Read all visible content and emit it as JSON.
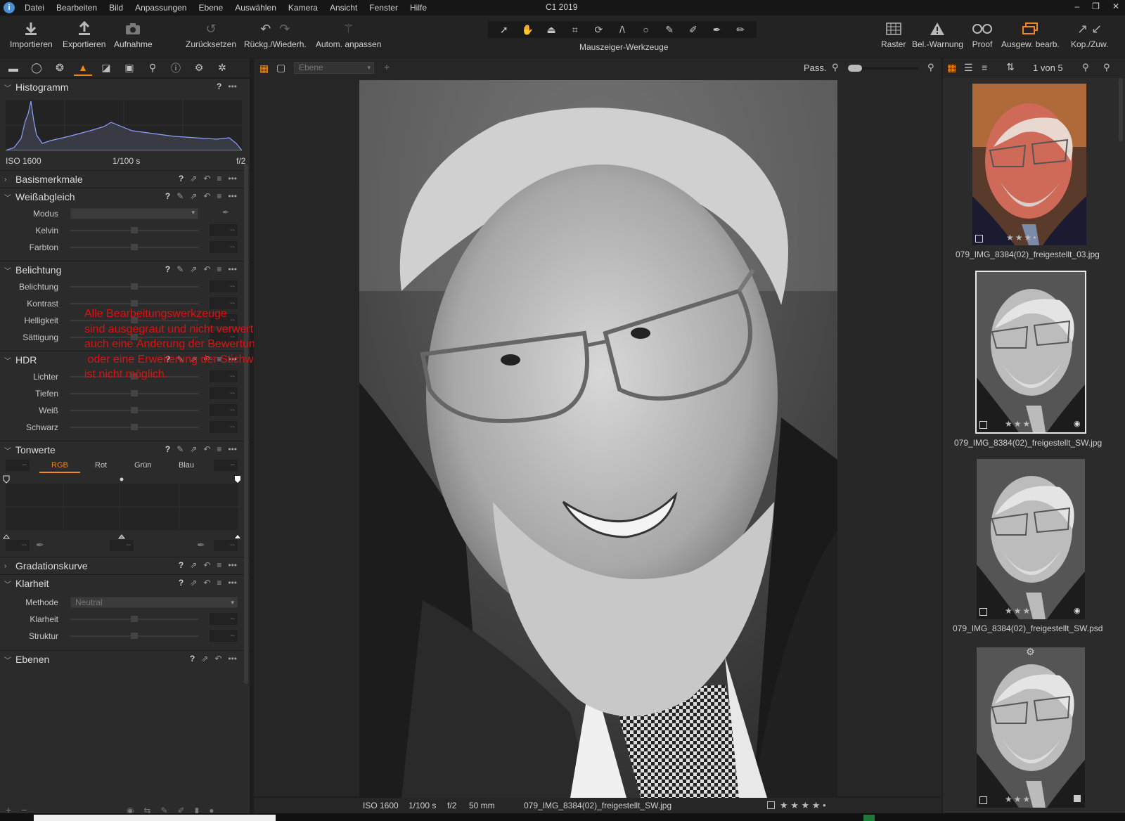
{
  "app": {
    "title": "C1 2019",
    "logo": "i"
  },
  "menu": [
    "Datei",
    "Bearbeiten",
    "Bild",
    "Anpassungen",
    "Ebene",
    "Auswählen",
    "Kamera",
    "Ansicht",
    "Fenster",
    "Hilfe"
  ],
  "window_controls": [
    "–",
    "❐",
    "✕"
  ],
  "toolbar": {
    "import": "Importieren",
    "export": "Exportieren",
    "capture": "Aufnahme",
    "reset": "Zurücksetzen",
    "undo_redo": "Rückg./Wiederh.",
    "auto_adjust": "Autom. anpassen",
    "cursor_tools": "Mauszeiger-Werkzeuge",
    "grid": "Raster",
    "exposure_warning": "Bel.-Warnung",
    "proof": "Proof",
    "edit_selected": "Ausgew. bearb.",
    "copy_apply": "Kop./Zuw."
  },
  "accent_color": "#f08a1c",
  "histogram": {
    "title": "Histogramm",
    "iso": "ISO 1600",
    "shutter": "1/100 s",
    "aperture": "f/2"
  },
  "sections": {
    "basic": "Basismerkmale",
    "white_balance": {
      "title": "Weißabgleich",
      "mode": "Modus",
      "kelvin": "Kelvin",
      "tint": "Farbton"
    },
    "exposure": {
      "title": "Belichtung",
      "exposure": "Belichtung",
      "contrast": "Kontrast",
      "brightness": "Helligkeit",
      "saturation": "Sättigung"
    },
    "hdr": {
      "title": "HDR",
      "highlights": "Lichter",
      "shadows": "Tiefen",
      "white": "Weiß",
      "black": "Schwarz"
    },
    "levels": {
      "title": "Tonwerte",
      "tabs": [
        "RGB",
        "Rot",
        "Grün",
        "Blau"
      ]
    },
    "curve": "Gradationskurve",
    "clarity": {
      "title": "Klarheit",
      "method": "Methode",
      "method_value": "Neutral",
      "clarity": "Klarheit",
      "structure": "Struktur"
    },
    "layers": "Ebenen"
  },
  "empty_value": "--",
  "annotation": "Alle Bearbeitungswerkzeuge\nsind ausgegraut und nicht verwertbar,\nauch eine Änderung der Bewertung\n oder eine Erweiterung der Stichwörter\nist nicht möglich.",
  "viewer": {
    "layer_select": "Ebene",
    "fit": "Pass.",
    "info": {
      "iso": "ISO 1600",
      "shutter": "1/100 s",
      "aperture": "f/2",
      "focal": "50 mm",
      "filename": "079_IMG_8384(02)_freigestellt_SW.jpg"
    },
    "rating": "★ ★ ★ ★ •"
  },
  "browser": {
    "count": "1 von 5",
    "items": [
      {
        "filename": "079_IMG_8384(02)_freigestellt_03.jpg",
        "rating": "★★★•"
      },
      {
        "filename": "079_IMG_8384(02)_freigestellt_SW.jpg",
        "rating": "★★★•"
      },
      {
        "filename": "079_IMG_8384(02)_freigestellt_SW.psd",
        "rating": "★★★•"
      },
      {
        "filename": "",
        "rating": "★★★•"
      }
    ]
  }
}
